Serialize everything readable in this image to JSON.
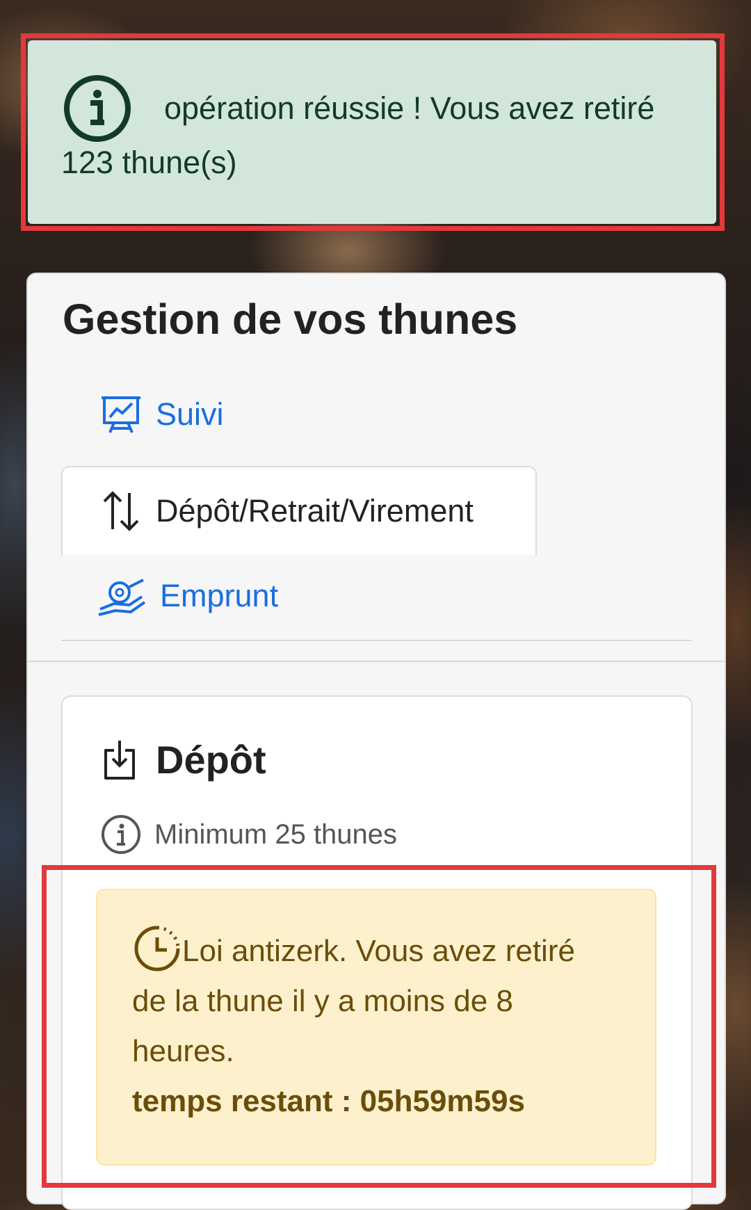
{
  "success_alert": {
    "message_line1": "opération réussie ! Vous avez retiré",
    "message_line2": "123 thune(s)",
    "icon": "info-circle-icon",
    "bg_color": "#d2e6dc",
    "text_color": "#133a26"
  },
  "card": {
    "title": "Gestion de vos thunes",
    "nav": [
      {
        "label": "Suivi",
        "icon": "presentation-chart-icon",
        "active": false
      },
      {
        "label": "Dépôt/Retrait/Virement",
        "icon": "arrows-up-down-icon",
        "active": true
      },
      {
        "label": "Emprunt",
        "icon": "hand-coin-icon",
        "active": false
      }
    ],
    "link_color": "#1a6ee0"
  },
  "depot": {
    "title": "Dépôt",
    "icon": "download-box-icon",
    "min_info": "Minimum 25 thunes",
    "min_icon": "info-circle-icon"
  },
  "warning": {
    "line1": "Loi antizerk. Vous avez retiré",
    "line2": "de la thune il y a moins de 8",
    "line3": "heures.",
    "remaining": "temps restant : 05h59m59s",
    "icon": "clock-icon",
    "bg_color": "#fdf1cd",
    "text_color": "#6b4d09"
  },
  "highlight_color": "#e3393d"
}
